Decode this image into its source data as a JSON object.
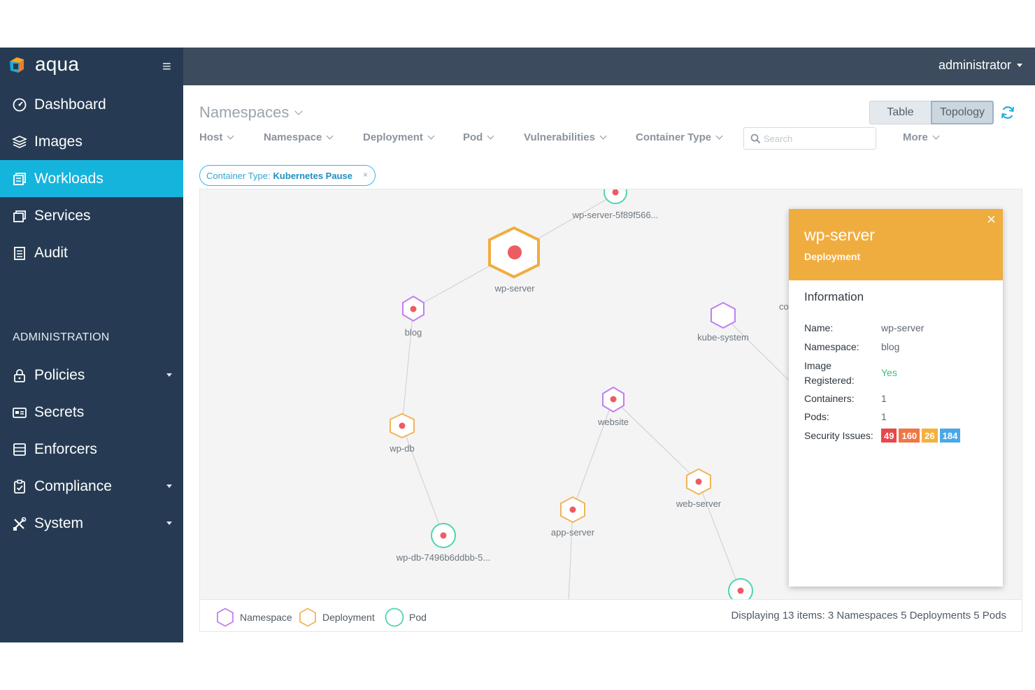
{
  "brand": {
    "name": "aqua"
  },
  "sidebar": {
    "items": [
      {
        "label": "Dashboard",
        "icon": "dashboard-icon"
      },
      {
        "label": "Images",
        "icon": "layers-icon"
      },
      {
        "label": "Workloads",
        "icon": "workloads-icon",
        "active": true
      },
      {
        "label": "Services",
        "icon": "services-icon"
      },
      {
        "label": "Audit",
        "icon": "audit-icon"
      }
    ],
    "admin_heading": "ADMINISTRATION",
    "admin_items": [
      {
        "label": "Policies",
        "icon": "lock-icon",
        "has_submenu": true
      },
      {
        "label": "Secrets",
        "icon": "secrets-icon"
      },
      {
        "label": "Enforcers",
        "icon": "enforcers-icon"
      },
      {
        "label": "Compliance",
        "icon": "compliance-icon",
        "has_submenu": true
      },
      {
        "label": "System",
        "icon": "tools-icon",
        "has_submenu": true
      }
    ]
  },
  "topbar": {
    "user": "administrator"
  },
  "main": {
    "title": "Namespaces",
    "filters": [
      "Host",
      "Namespace",
      "Deployment",
      "Pod",
      "Vulnerabilities",
      "Container Type"
    ],
    "search_placeholder": "Search",
    "more_label": "More",
    "view_toggle": {
      "table": "Table",
      "topology": "Topology",
      "selected": "Topology"
    },
    "chip": {
      "label": "Container Type:",
      "value": "Kubernetes Pause"
    }
  },
  "graph": {
    "nodes": [
      {
        "label": "wp-server-5f89f566...",
        "type": "pod"
      },
      {
        "label": "wp-server",
        "type": "deployment",
        "selected": true
      },
      {
        "label": "blog",
        "type": "namespace"
      },
      {
        "label": "wp-db",
        "type": "deployment"
      },
      {
        "label": "wp-db-7496b6ddbb-5...",
        "type": "pod"
      },
      {
        "label": "website",
        "type": "namespace"
      },
      {
        "label": "app-server",
        "type": "deployment"
      },
      {
        "label": "web-server",
        "type": "deployment"
      },
      {
        "label": "kube-system",
        "type": "namespace"
      },
      {
        "label": "co",
        "type": "partial"
      }
    ],
    "colors": {
      "namespace": "#c07ff0",
      "deployment": "#f2b45a",
      "pod": "#4cd6b0",
      "dot": "#ef5b62"
    }
  },
  "legend": {
    "namespace": "Namespace",
    "deployment": "Deployment",
    "pod": "Pod",
    "summary": "Displaying 13 items: 3 Namespaces 5 Deployments 5 Pods"
  },
  "popup": {
    "title": "wp-server",
    "subtitle": "Deployment",
    "section": "Information",
    "rows": [
      {
        "label": "Name:",
        "value": "wp-server"
      },
      {
        "label": "Namespace:",
        "value": "blog"
      },
      {
        "label": "Image Registered:",
        "label_line1": "Image",
        "label_line2": "Registered:",
        "value": "Yes"
      },
      {
        "label": "Containers:",
        "value": "1"
      },
      {
        "label": "Pods:",
        "value": "1"
      }
    ],
    "security_label": "Security Issues:",
    "security_issues": [
      {
        "count": "49",
        "color": "#e8474b"
      },
      {
        "count": "160",
        "color": "#f07645"
      },
      {
        "count": "26",
        "color": "#f5b13e"
      },
      {
        "count": "184",
        "color": "#4aa8e8"
      }
    ],
    "accent": "#f0ad3f"
  }
}
